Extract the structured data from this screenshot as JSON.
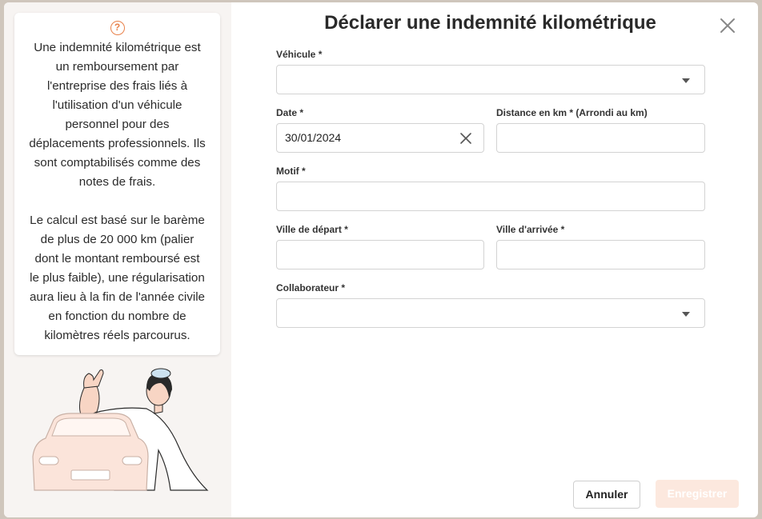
{
  "dialog": {
    "title": "Déclarer une indemnité kilométrique"
  },
  "info": {
    "icon": "question-circle-icon",
    "paragraph1": "Une indemnité kilométrique est\nun remboursement par\nl'entreprise des frais liés à\nl'utilisation d'un véhicule\npersonnel pour des\ndéplacements professionnels. Ils\nsont comptabilisés comme des\nnotes de frais.",
    "paragraph2": "Le calcul est basé sur le barème\nde plus de 20 000 km (palier\ndont le montant remboursé est\nle plus faible), une régularisation\naura lieu à la fin de l'année civile\nen fonction du nombre de\nkilomètres réels parcourus."
  },
  "form": {
    "vehicle": {
      "label": "Véhicule *",
      "value": ""
    },
    "date": {
      "label": "Date *",
      "value": "30/01/2024"
    },
    "distance": {
      "label": "Distance en km * (Arrondi au km)",
      "value": ""
    },
    "motif": {
      "label": "Motif *",
      "value": ""
    },
    "departure": {
      "label": "Ville de départ *",
      "value": ""
    },
    "arrival": {
      "label": "Ville d'arrivée *",
      "value": ""
    },
    "collaborator": {
      "label": "Collaborateur *",
      "value": ""
    }
  },
  "actions": {
    "cancel_label": "Annuler",
    "save_label": "Enregistrer"
  },
  "colors": {
    "accent": "#e8814a",
    "save_disabled_bg": "#fce8de"
  }
}
